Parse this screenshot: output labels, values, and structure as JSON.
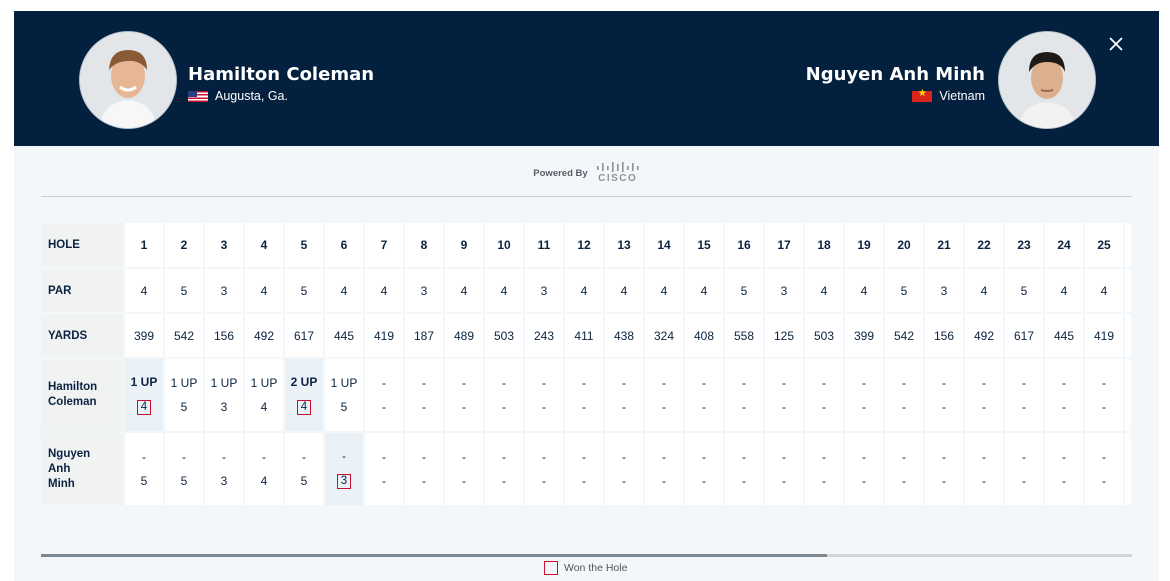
{
  "players": [
    {
      "name": "Hamilton Coleman",
      "location": "Augusta, Ga.",
      "flag": "us-flag"
    },
    {
      "name": "Nguyen Anh Minh",
      "location": "Vietnam",
      "flag": "vietnam-flag"
    }
  ],
  "powered_by": "Powered By",
  "sponsor": "CISCO",
  "row_labels": {
    "hole": "HOLE",
    "par": "PAR",
    "yards": "YARDS",
    "player1": "Hamilton Coleman",
    "player2": "Nguyen Anh Minh"
  },
  "holes": [
    "1",
    "2",
    "3",
    "4",
    "5",
    "6",
    "7",
    "8",
    "9",
    "10",
    "11",
    "12",
    "13",
    "14",
    "15",
    "16",
    "17",
    "18",
    "19",
    "20",
    "21",
    "22",
    "23",
    "24",
    "25"
  ],
  "par": [
    "4",
    "5",
    "3",
    "4",
    "5",
    "4",
    "4",
    "3",
    "4",
    "4",
    "3",
    "4",
    "4",
    "4",
    "4",
    "5",
    "3",
    "4",
    "4",
    "5",
    "3",
    "4",
    "5",
    "4",
    "4"
  ],
  "yards": [
    "399",
    "542",
    "156",
    "492",
    "617",
    "445",
    "419",
    "187",
    "489",
    "503",
    "243",
    "411",
    "438",
    "324",
    "408",
    "558",
    "125",
    "503",
    "399",
    "542",
    "156",
    "492",
    "617",
    "445",
    "419"
  ],
  "player1_status": [
    "1 UP",
    "1 UP",
    "1 UP",
    "1 UP",
    "2 UP",
    "1 UP",
    "-",
    "-",
    "-",
    "-",
    "-",
    "-",
    "-",
    "-",
    "-",
    "-",
    "-",
    "-",
    "-",
    "-",
    "-",
    "-",
    "-",
    "-",
    "-"
  ],
  "player1_scores": [
    "4",
    "5",
    "3",
    "4",
    "4",
    "5",
    "-",
    "-",
    "-",
    "-",
    "-",
    "-",
    "-",
    "-",
    "-",
    "-",
    "-",
    "-",
    "-",
    "-",
    "-",
    "-",
    "-",
    "-",
    "-"
  ],
  "player1_won": [
    1,
    5
  ],
  "player1_lead": [
    1,
    5
  ],
  "player2_status": [
    "-",
    "-",
    "-",
    "-",
    "-",
    "-",
    "-",
    "-",
    "-",
    "-",
    "-",
    "-",
    "-",
    "-",
    "-",
    "-",
    "-",
    "-",
    "-",
    "-",
    "-",
    "-",
    "-",
    "-",
    "-"
  ],
  "player2_scores": [
    "5",
    "5",
    "3",
    "4",
    "5",
    "3",
    "-",
    "-",
    "-",
    "-",
    "-",
    "-",
    "-",
    "-",
    "-",
    "-",
    "-",
    "-",
    "-",
    "-",
    "-",
    "-",
    "-",
    "-",
    "-"
  ],
  "player2_won": [
    6
  ],
  "player2_lead": [
    6
  ],
  "scroll_position": 0.72,
  "legend": "Won the Hole",
  "colors": {
    "header": "#03213f",
    "won_border": "#c8102e",
    "lead_bg": "#eaf2f8"
  }
}
